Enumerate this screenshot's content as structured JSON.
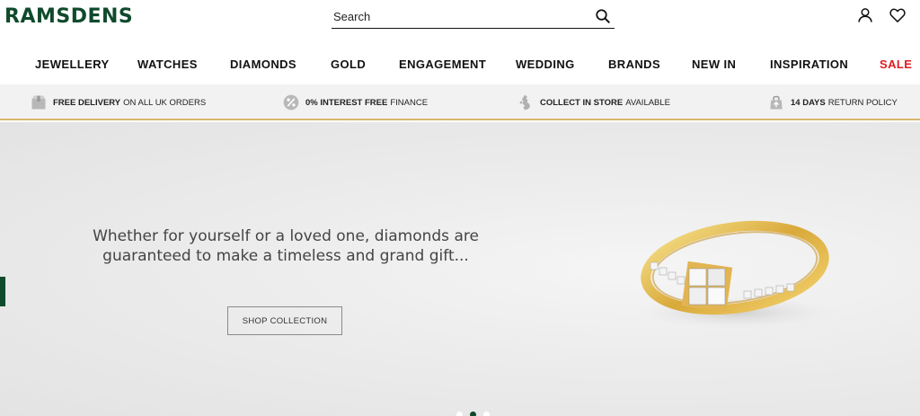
{
  "header": {
    "logo": "RAMSDENS",
    "search_placeholder": "Search"
  },
  "nav": {
    "items": [
      "JEWELLERY",
      "WATCHES",
      "DIAMONDS",
      "GOLD",
      "ENGAGEMENT",
      "WEDDING",
      "BRANDS",
      "NEW IN",
      "INSPIRATION",
      "SALE"
    ]
  },
  "usp": [
    {
      "bold": "FREE DELIVERY",
      "rest": "ON ALL UK ORDERS",
      "icon": "delivery-box-icon"
    },
    {
      "bold": "0% INTEREST FREE",
      "rest": "FINANCE",
      "icon": "percent-icon"
    },
    {
      "bold": "COLLECT IN STORE",
      "rest": "AVAILABLE",
      "icon": "uk-map-icon"
    },
    {
      "bold": "14 DAYS",
      "rest": "RETURN POLICY",
      "icon": "returns-bag-icon"
    }
  ],
  "hero": {
    "line1": "Whether for yourself or a loved one, diamonds are",
    "line2": "guaranteed to make a timeless and grand gift...",
    "button": "SHOP COLLECTION"
  },
  "colors": {
    "brand_green": "#0f4a2c",
    "sale_red": "#e11b22",
    "usp_border_gold": "#d8b86a"
  }
}
